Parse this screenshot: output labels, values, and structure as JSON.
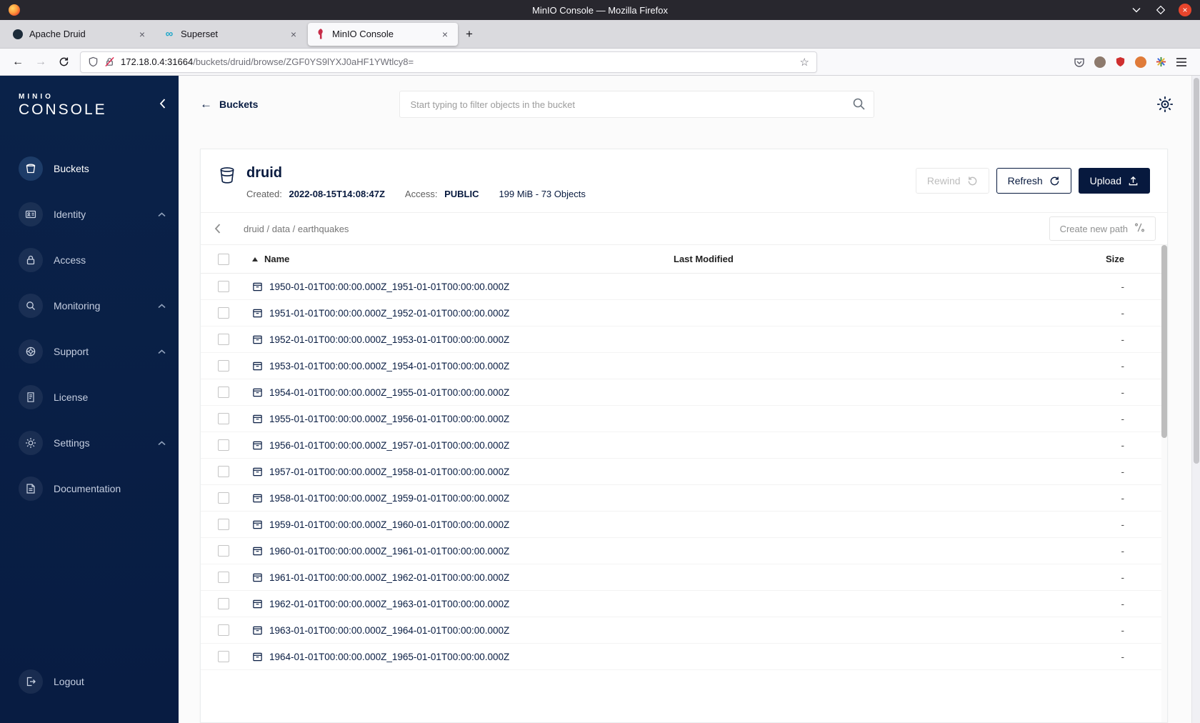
{
  "browser": {
    "window_title": "MinIO Console — Mozilla Firefox",
    "tabs": [
      {
        "label": "Apache Druid",
        "icon": "druid-icon",
        "active": false
      },
      {
        "label": "Superset",
        "icon": "superset-icon",
        "active": false
      },
      {
        "label": "MinIO Console",
        "icon": "minio-icon",
        "active": true
      }
    ],
    "url_host": "172.18.0.4:31664",
    "url_path": "/buckets/druid/browse/ZGF0YS9lYXJ0aHF1YWtlcy8="
  },
  "sidebar": {
    "logo_small": "MINIO",
    "logo_large": "CONSOLE",
    "items": [
      {
        "label": "Buckets",
        "icon": "bucket-icon",
        "active": true,
        "expandable": false
      },
      {
        "label": "Identity",
        "icon": "identity-icon",
        "active": false,
        "expandable": true
      },
      {
        "label": "Access",
        "icon": "access-icon",
        "active": false,
        "expandable": false
      },
      {
        "label": "Monitoring",
        "icon": "monitoring-icon",
        "active": false,
        "expandable": true
      },
      {
        "label": "Support",
        "icon": "support-icon",
        "active": false,
        "expandable": true
      },
      {
        "label": "License",
        "icon": "license-icon",
        "active": false,
        "expandable": false
      },
      {
        "label": "Settings",
        "icon": "settings-icon",
        "active": false,
        "expandable": true
      },
      {
        "label": "Documentation",
        "icon": "documentation-icon",
        "active": false,
        "expandable": false
      }
    ],
    "logout": {
      "label": "Logout",
      "icon": "logout-icon"
    }
  },
  "topbar": {
    "back_label": "Buckets",
    "search_placeholder": "Start typing to filter objects in the bucket"
  },
  "bucket": {
    "name": "druid",
    "created_label": "Created:",
    "created_value": "2022-08-15T14:08:47Z",
    "access_label": "Access:",
    "access_value": "PUBLIC",
    "summary": "199 MiB - 73 Objects",
    "rewind_label": "Rewind",
    "refresh_label": "Refresh",
    "upload_label": "Upload"
  },
  "path_bar": {
    "breadcrumb": "druid / data / earthquakes",
    "create_new_path_label": "Create new path"
  },
  "table": {
    "headers": {
      "name": "Name",
      "last_modified": "Last Modified",
      "size": "Size"
    },
    "rows": [
      {
        "name": "1950-01-01T00:00:00.000Z_1951-01-01T00:00:00.000Z",
        "size": "-"
      },
      {
        "name": "1951-01-01T00:00:00.000Z_1952-01-01T00:00:00.000Z",
        "size": "-"
      },
      {
        "name": "1952-01-01T00:00:00.000Z_1953-01-01T00:00:00.000Z",
        "size": "-"
      },
      {
        "name": "1953-01-01T00:00:00.000Z_1954-01-01T00:00:00.000Z",
        "size": "-"
      },
      {
        "name": "1954-01-01T00:00:00.000Z_1955-01-01T00:00:00.000Z",
        "size": "-"
      },
      {
        "name": "1955-01-01T00:00:00.000Z_1956-01-01T00:00:00.000Z",
        "size": "-"
      },
      {
        "name": "1956-01-01T00:00:00.000Z_1957-01-01T00:00:00.000Z",
        "size": "-"
      },
      {
        "name": "1957-01-01T00:00:00.000Z_1958-01-01T00:00:00.000Z",
        "size": "-"
      },
      {
        "name": "1958-01-01T00:00:00.000Z_1959-01-01T00:00:00.000Z",
        "size": "-"
      },
      {
        "name": "1959-01-01T00:00:00.000Z_1960-01-01T00:00:00.000Z",
        "size": "-"
      },
      {
        "name": "1960-01-01T00:00:00.000Z_1961-01-01T00:00:00.000Z",
        "size": "-"
      },
      {
        "name": "1961-01-01T00:00:00.000Z_1962-01-01T00:00:00.000Z",
        "size": "-"
      },
      {
        "name": "1962-01-01T00:00:00.000Z_1963-01-01T00:00:00.000Z",
        "size": "-"
      },
      {
        "name": "1963-01-01T00:00:00.000Z_1964-01-01T00:00:00.000Z",
        "size": "-"
      },
      {
        "name": "1964-01-01T00:00:00.000Z_1965-01-01T00:00:00.000Z",
        "size": "-"
      }
    ]
  },
  "colors": {
    "accent": "#081C42",
    "brand_red": "#C72C48",
    "link": "#07193E"
  }
}
